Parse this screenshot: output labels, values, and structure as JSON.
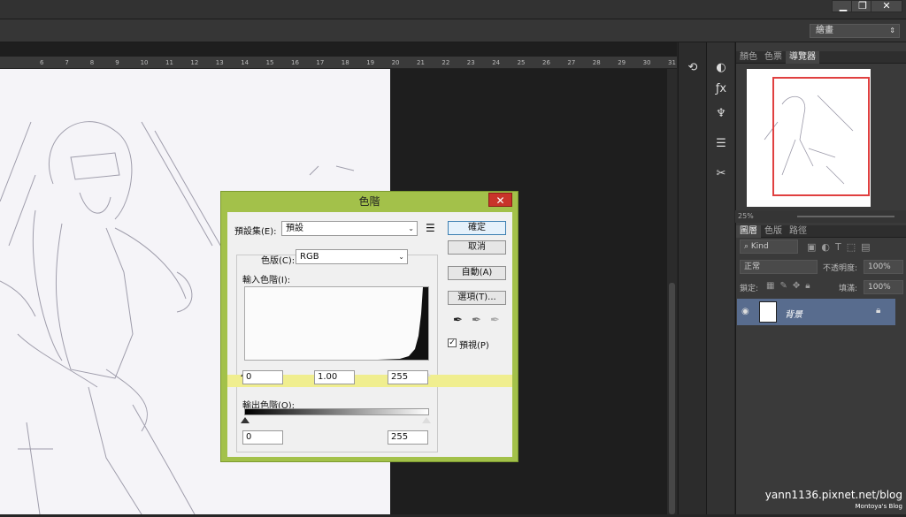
{
  "window": {
    "minimize": "▁",
    "restore": "❐",
    "close": "✕"
  },
  "options_bar": {
    "workspace": "繪畫"
  },
  "ruler": {
    "ticks": [
      "6",
      "7",
      "8",
      "9",
      "10",
      "11",
      "12",
      "13",
      "14",
      "15",
      "16",
      "17",
      "18",
      "19",
      "20",
      "21",
      "22",
      "23",
      "24",
      "25",
      "26",
      "27",
      "28",
      "29",
      "30",
      "31"
    ]
  },
  "right_panel": {
    "top_tabs": [
      "顏色",
      "色票",
      "導覽器"
    ],
    "zoom": "25%",
    "layer_tabs": [
      "圖層",
      "色版",
      "路徑"
    ],
    "kind": "Kind",
    "blend_mode": "正常",
    "opacity_label": "不透明度:",
    "opacity": "100%",
    "lock_label": "鎖定:",
    "fill_label": "填滿:",
    "fill": "100%",
    "layer_name": "背景",
    "credit_url": "yann1136.pixnet.net/blog",
    "credit_sub": "Montoya's Blog"
  },
  "dialog": {
    "title": "色階",
    "close": "✕",
    "preset_label": "預設集(E):",
    "preset_value": "預設",
    "channel_label": "色版(C):",
    "channel_value": "RGB",
    "input_label": "輸入色階(I):",
    "input_black": "0",
    "input_gamma": "1.00",
    "input_white": "255",
    "output_label": "輸出色階(O):",
    "output_black": "0",
    "output_white": "255",
    "ok": "確定",
    "cancel": "取消",
    "auto": "自動(A)",
    "options": "選項(T)...",
    "preview": "預視(P)",
    "preview_checked": true
  },
  "colors": {
    "dialog_frame": "#a3c14a",
    "highlight": "#f0ee8f",
    "close_red": "#c8342a",
    "layer_selected": "#586c8e",
    "nav_frame": "#e04040"
  }
}
